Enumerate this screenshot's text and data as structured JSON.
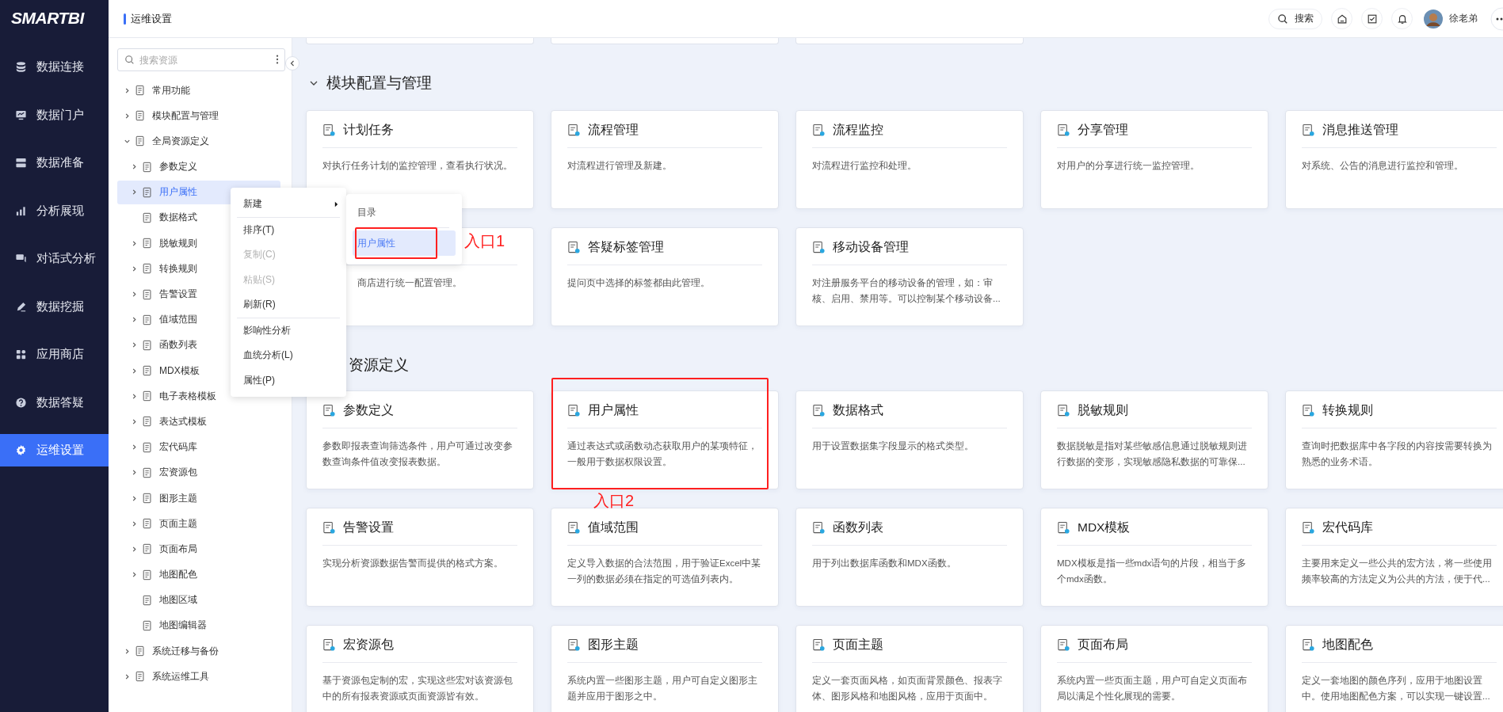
{
  "logo": "SMARTBI",
  "nav": [
    {
      "label": "数据连接",
      "kind": "database",
      "selected": false
    },
    {
      "label": "数据门户",
      "kind": "monitor",
      "selected": false
    },
    {
      "label": "数据准备",
      "kind": "server",
      "selected": false
    },
    {
      "label": "分析展现",
      "kind": "bars",
      "selected": false
    },
    {
      "label": "对话式分析",
      "kind": "chat",
      "selected": false
    },
    {
      "label": "数据挖掘",
      "kind": "pen",
      "selected": false
    },
    {
      "label": "应用商店",
      "kind": "grid",
      "selected": false
    },
    {
      "label": "数据答疑",
      "kind": "question",
      "selected": false
    },
    {
      "label": "运维设置",
      "kind": "gear",
      "selected": true
    }
  ],
  "header": {
    "title": "运维设置",
    "search": "搜索",
    "user": "徐老弟"
  },
  "tree": {
    "search_placeholder": "搜索资源",
    "items": [
      {
        "label": "常用功能",
        "expanded": false,
        "selected": false
      },
      {
        "label": "模块配置与管理",
        "expanded": false,
        "selected": false
      },
      {
        "label": "全局资源定义",
        "expanded": true,
        "selected": false,
        "children": [
          {
            "label": "参数定义",
            "expanded": false,
            "selected": false
          },
          {
            "label": "用户属性",
            "expanded": false,
            "selected": true
          },
          {
            "label": "数据格式",
            "selected": false
          },
          {
            "label": "脱敏规则",
            "expanded": false,
            "selected": false
          },
          {
            "label": "转换规则",
            "expanded": false,
            "selected": false
          },
          {
            "label": "告警设置",
            "expanded": false,
            "selected": false
          },
          {
            "label": "值域范围",
            "expanded": false,
            "selected": false
          },
          {
            "label": "函数列表",
            "expanded": false,
            "selected": false
          },
          {
            "label": "MDX模板",
            "expanded": false,
            "selected": false
          },
          {
            "label": "电子表格模板",
            "expanded": false,
            "selected": false
          },
          {
            "label": "表达式模板",
            "expanded": false,
            "selected": false
          },
          {
            "label": "宏代码库",
            "expanded": false,
            "selected": false
          },
          {
            "label": "宏资源包",
            "expanded": false,
            "selected": false
          },
          {
            "label": "图形主题",
            "expanded": false,
            "selected": false
          },
          {
            "label": "页面主题",
            "expanded": false,
            "selected": false
          },
          {
            "label": "页面布局",
            "expanded": false,
            "selected": false
          },
          {
            "label": "地图配色",
            "expanded": false,
            "selected": false
          },
          {
            "label": "地图区域",
            "selected": false
          },
          {
            "label": "地图编辑器",
            "selected": false
          }
        ]
      },
      {
        "label": "系统迁移与备份",
        "expanded": false,
        "selected": false
      },
      {
        "label": "系统运维工具",
        "expanded": false,
        "selected": false
      }
    ]
  },
  "cut_cards": [
    {
      "kind": "card"
    },
    {
      "kind": "card"
    },
    {
      "kind": "card"
    }
  ],
  "sections": [
    {
      "title": "模块配置与管理",
      "cards": [
        {
          "title": "计划任务",
          "description": "对执行任务计划的监控管理，查看执行状况。"
        },
        {
          "title": "流程管理",
          "description": "对流程进行管理及新建。"
        },
        {
          "title": "流程监控",
          "description": "对流程进行监控和处理。"
        },
        {
          "title": "分享管理",
          "description": "对用户的分享进行统一监控管理。"
        },
        {
          "title": "消息推送管理",
          "description": "对系统、公告的消息进行监控和管理。"
        },
        {
          "description": "商店进行统一配置管理。"
        },
        {
          "title": "答疑标签管理",
          "description": "提问页中选择的标签都由此管理。"
        },
        {
          "title": "移动设备管理",
          "description": "对注册服务平台的移动设备的管理，如：审核、启用、禁用等。可以控制某个移动设备..."
        }
      ]
    },
    {
      "title": "资源定义",
      "cards": [
        {
          "title": "参数定义",
          "description": "参数即报表查询筛选条件，用户可通过改变参数查询条件值改变报表数据。"
        },
        {
          "title": "用户属性",
          "description": "通过表达式或函数动态获取用户的某项特征，一般用于数据权限设置。"
        },
        {
          "title": "数据格式",
          "description": "用于设置数据集字段显示的格式类型。"
        },
        {
          "title": "脱敏规则",
          "description": "数据脱敏是指对某些敏感信息通过脱敏规则进行数据的变形，实现敏感隐私数据的可靠保..."
        },
        {
          "title": "转换规则",
          "description": "查询时把数据库中各字段的内容按需要转换为熟悉的业务术语。"
        },
        {
          "title": "告警设置",
          "description": "实现分析资源数据告警而提供的格式方案。"
        },
        {
          "title": "值域范围",
          "description": "定义导入数据的合法范围，用于验证Excel中某一列的数据必须在指定的可选值列表内。"
        },
        {
          "title": "函数列表",
          "description": "用于列出数据库函数和MDX函数。"
        },
        {
          "title": "MDX模板",
          "description": "MDX模板是指一些mdx语句的片段，相当于多个mdx函数。"
        },
        {
          "title": "宏代码库",
          "description": "主要用来定义一些公共的宏方法，将一些使用频率较高的方法定义为公共的方法，便于代..."
        },
        {
          "title": "宏资源包",
          "description": "基于资源包定制的宏，实现这些宏对该资源包中的所有报表资源或页面资源皆有效。"
        },
        {
          "title": "图形主题",
          "description": "系统内置一些图形主题，用户可自定义图形主题并应用于图形之中。"
        },
        {
          "title": "页面主题",
          "description": "定义一套页面风格，如页面背景颜色、报表字体、图形风格和地图风格，应用于页面中。"
        },
        {
          "title": "页面布局",
          "description": "系统内置一些页面主题，用户可自定义页面布局以满足个性化展现的需要。"
        },
        {
          "title": "地图配色",
          "description": "定义一套地图的颜色序列，应用于地图设置中。使用地图配色方案，可以实现一键设置..."
        }
      ]
    }
  ],
  "context_menu": {
    "items": [
      {
        "kind": "item",
        "label": "新建",
        "disabled": false,
        "submenu": true
      },
      {
        "kind": "separator"
      },
      {
        "kind": "item",
        "label": "排序(T)",
        "disabled": false,
        "submenu": false
      },
      {
        "kind": "item",
        "label": "复制(C)",
        "disabled": true,
        "submenu": false
      },
      {
        "kind": "item",
        "label": "粘贴(S)",
        "disabled": true,
        "submenu": false
      },
      {
        "kind": "item",
        "label": "刷新(R)",
        "disabled": false,
        "submenu": false
      },
      {
        "kind": "separator"
      },
      {
        "kind": "item",
        "label": "影响性分析",
        "disabled": false,
        "submenu": false
      },
      {
        "kind": "item",
        "label": "血统分析(L)",
        "disabled": false,
        "submenu": false
      },
      {
        "kind": "item",
        "label": "属性(P)",
        "disabled": false,
        "submenu": false
      }
    ],
    "submenu": [
      {
        "label": "目录",
        "selected": false
      },
      {
        "label": "用户属性",
        "selected": true
      }
    ]
  },
  "annotations": [
    {
      "label": "入口1"
    },
    {
      "label": "入口2"
    }
  ]
}
